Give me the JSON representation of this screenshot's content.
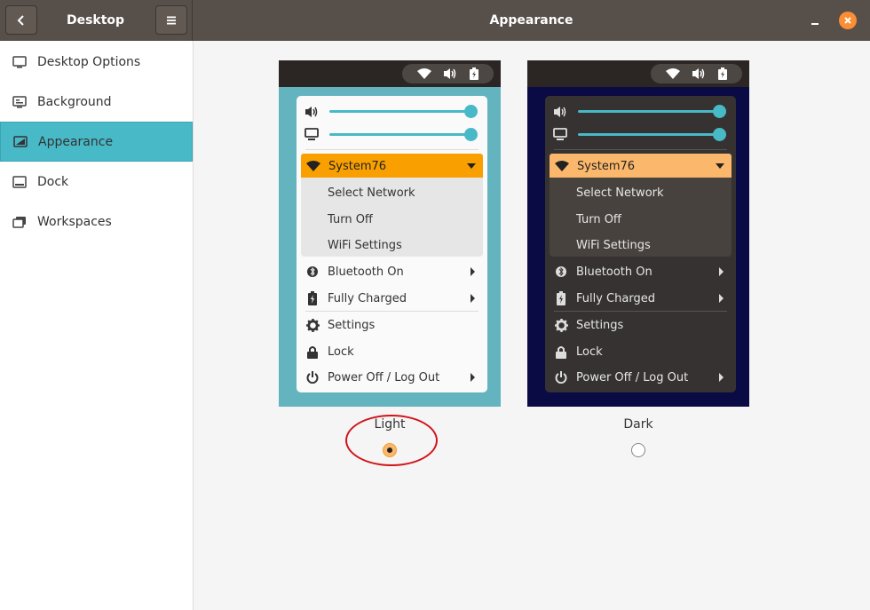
{
  "header": {
    "sidebar_title": "Desktop",
    "main_title": "Appearance"
  },
  "sidebar": {
    "items": [
      {
        "label": "Desktop Options",
        "icon": "monitor-icon",
        "active": false
      },
      {
        "label": "Background",
        "icon": "wallpaper-icon",
        "active": false
      },
      {
        "label": "Appearance",
        "icon": "appearance-icon",
        "active": true
      },
      {
        "label": "Dock",
        "icon": "dock-icon",
        "active": false
      },
      {
        "label": "Workspaces",
        "icon": "workspaces-icon",
        "active": false
      }
    ]
  },
  "preview_menu": {
    "network_name": "System76",
    "network_items": [
      "Select Network",
      "Turn Off",
      "WiFi Settings"
    ],
    "bluetooth": "Bluetooth On",
    "battery": "Fully Charged",
    "settings": "Settings",
    "lock": "Lock",
    "power": "Power Off / Log Out"
  },
  "themes": {
    "light": {
      "label": "Light",
      "selected": true
    },
    "dark": {
      "label": "Dark",
      "selected": false
    }
  },
  "colors": {
    "accent": "#48b9c7",
    "highlight": "#fbb86c",
    "header": "#574f4a",
    "light_bg": "#63b4bf",
    "dark_bg": "#0d0d4a"
  }
}
